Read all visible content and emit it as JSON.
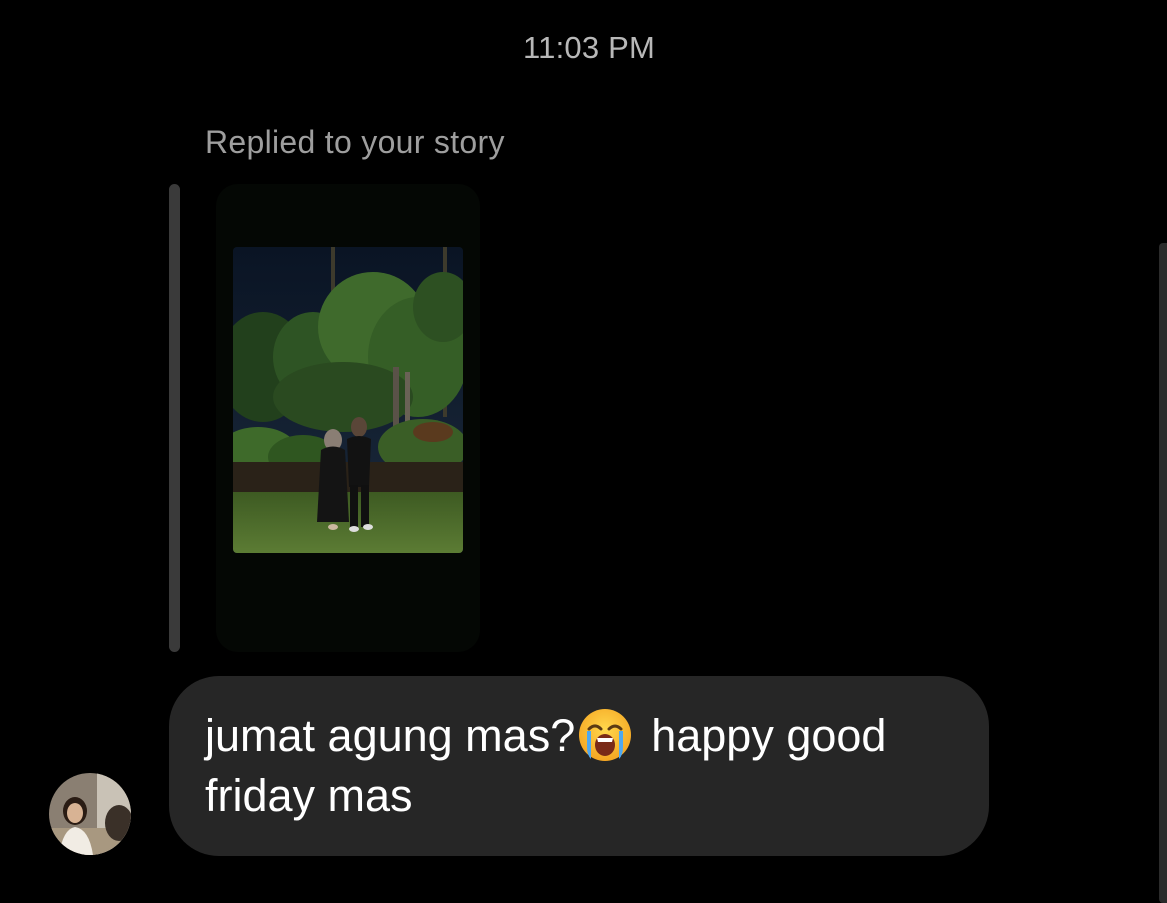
{
  "timestamp": "11:03 PM",
  "reply_label": "Replied to your story",
  "message": {
    "line1_before_emoji": "jumat agung mas?",
    "emoji": "loudly-crying-face-emoji",
    "line1_after_emoji": "happy good",
    "line2": "friday mas"
  },
  "icons": {
    "emoji": "loudly-crying-face-icon"
  },
  "colors": {
    "background": "#000000",
    "bubble": "#262626",
    "muted_text": "#9e9e9e",
    "timestamp_text": "#b8b8b8",
    "reply_bar": "#3a3a3a"
  }
}
